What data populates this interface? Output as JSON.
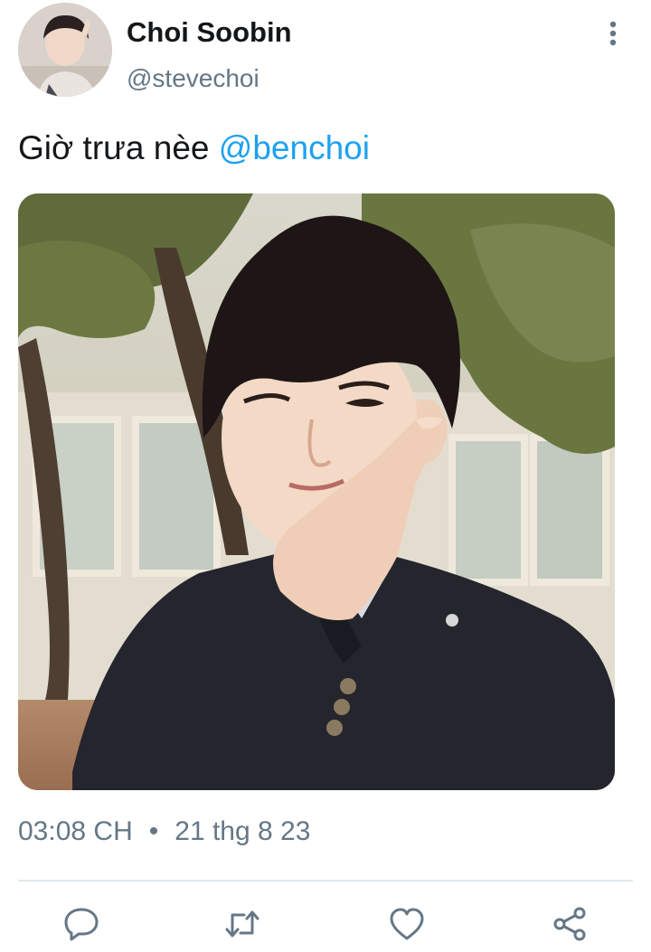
{
  "author": {
    "display_name": "Choi Soobin",
    "handle": "@stevechoi"
  },
  "tweet": {
    "text": "Giờ trưa nèe ",
    "mention": "@benchoi"
  },
  "meta": {
    "time": "03:08 CH",
    "separator": "•",
    "date": "21 thg 8 23"
  },
  "icons": {
    "more": "more-vertical-icon",
    "reply": "reply-icon",
    "retweet": "retweet-icon",
    "like": "heart-icon",
    "share": "share-icon"
  },
  "colors": {
    "mention": "#1da1f2",
    "secondary_text": "#657786",
    "primary_text": "#14171a",
    "divider": "#e1e8ed"
  }
}
